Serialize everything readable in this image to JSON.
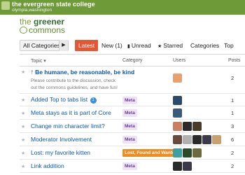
{
  "college": {
    "name": "the evergreen state college",
    "location": "olympia,washington"
  },
  "brand": {
    "prefix": "the ",
    "emphasis": "greener",
    "suffix": "commons"
  },
  "nav": {
    "category_dropdown": "All Categories",
    "tabs": [
      {
        "label": "Latest",
        "active": true
      },
      {
        "label": "New (1)"
      },
      {
        "label": "Unread",
        "icon": "bookmark-icon"
      },
      {
        "label": "Starred",
        "icon": "star-icon"
      },
      {
        "label": "Categories"
      },
      {
        "label": "Top"
      }
    ]
  },
  "table": {
    "headers": {
      "topic": "Topic",
      "category": "Category",
      "users": "Users",
      "posts": "Posts"
    },
    "rows": [
      {
        "title": "Be humane, be reasonable, be kind",
        "pinned": true,
        "excerpt": "Please contribute to the discussion, check out the commons guidelines, and have fun!",
        "category": "",
        "posts": "2",
        "avatar_colors": [
          "#e8a070"
        ]
      },
      {
        "title": "Added Top to tabs list",
        "badge": "1",
        "category": "Meta",
        "category_color": "#ede3f5",
        "category_text": "#6a3d96",
        "posts": "1",
        "avatar_colors": [
          "#2a4a6a"
        ]
      },
      {
        "title": "Meta stays as it is part of Core",
        "category": "Meta",
        "category_color": "#ede3f5",
        "category_text": "#6a3d96",
        "posts": "1",
        "avatar_colors": [
          "#3a5a7a"
        ]
      },
      {
        "title": "Change min character limit?",
        "category": "Meta",
        "category_color": "#ede3f5",
        "category_text": "#6a3d96",
        "posts": "3",
        "avatar_colors": [
          "#c98060",
          "#2a2a2a",
          "#4a3a2a"
        ]
      },
      {
        "title": "Moderator Involvement",
        "category": "Meta",
        "category_color": "#ede3f5",
        "category_text": "#6a3d96",
        "posts": "6",
        "avatar_colors": [
          "#6a4a3a",
          "#b0b0b0",
          "#2a2a2a",
          "#3a3a4a",
          "#c9a070"
        ]
      },
      {
        "title": "Lost: my favorite kitten",
        "category": "Lost, Found and Wanted",
        "category_color": "#f08c1e",
        "category_text": "#ffffff",
        "posts": "2",
        "avatar_colors": [
          "#3aa0a0",
          "#2a4a2a",
          "#6a6a3a"
        ]
      },
      {
        "title": "Link addition",
        "category": "Meta",
        "category_color": "#ede3f5",
        "category_text": "#6a3d96",
        "posts": "2",
        "avatar_colors": [
          "#2a2a2a",
          "#3a3a4a"
        ]
      }
    ]
  },
  "colors": {
    "header_green": "#6e9a38",
    "active_tab": "#e45735",
    "link": "#0a58b5"
  }
}
